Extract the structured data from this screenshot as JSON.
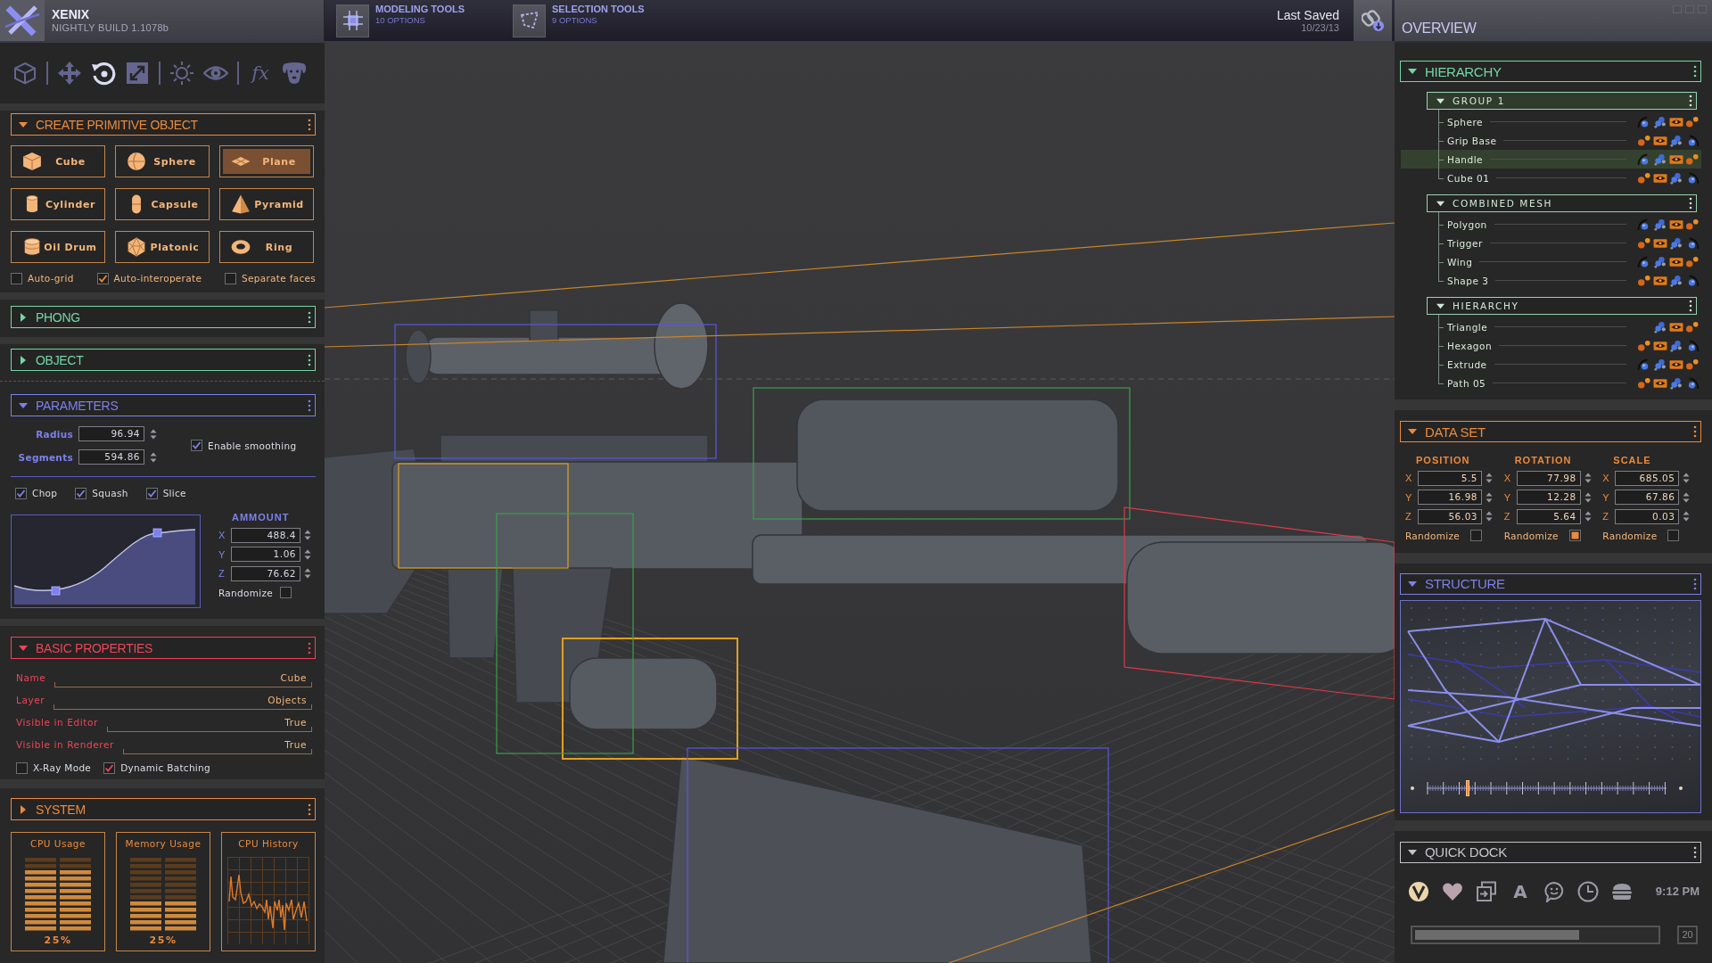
{
  "app": {
    "title": "XENIX",
    "build": "NIGHTLY BUILD 1.1078b"
  },
  "top_tools": [
    {
      "title": "MODELING TOOLS",
      "subtitle": "10 OPTIONS"
    },
    {
      "title": "SELECTION TOOLS",
      "subtitle": "9 OPTIONS"
    }
  ],
  "save_status": {
    "label": "Last Saved",
    "date": "10/23/13"
  },
  "toolbar": {
    "tools": [
      {
        "selected": false
      },
      {
        "selected": false
      },
      {
        "selected": true
      },
      {
        "selected": false
      },
      {
        "selected": false
      },
      {
        "selected": false
      },
      {
        "label": "fx",
        "selected": false
      },
      {
        "selected": false
      }
    ]
  },
  "create_primitive": {
    "title": "CREATE PRIMITIVE OBJECT",
    "expanded": true,
    "buttons": [
      {
        "label": "Cube",
        "selected": false
      },
      {
        "label": "Sphere",
        "selected": false
      },
      {
        "label": "Plane",
        "selected": true
      },
      {
        "label": "Cylinder",
        "selected": false
      },
      {
        "label": "Capsule",
        "selected": false
      },
      {
        "label": "Pyramid",
        "selected": false
      },
      {
        "label": "Oil Drum",
        "selected": false
      },
      {
        "label": "Platonic",
        "selected": false
      },
      {
        "label": "Ring",
        "selected": false
      }
    ],
    "options": [
      {
        "label": "Auto-grid",
        "checked": false
      },
      {
        "label": "Auto-interoperate",
        "checked": true
      },
      {
        "label": "Separate faces",
        "checked": false
      }
    ]
  },
  "phong": {
    "title": "PHONG",
    "expanded": false
  },
  "object": {
    "title": "OBJECT",
    "expanded": false
  },
  "parameters": {
    "title": "PARAMETERS",
    "expanded": true,
    "fields": [
      {
        "label": "Radius",
        "value": "96.94"
      },
      {
        "label": "Segments",
        "value": "594.86"
      }
    ],
    "smoothing": {
      "label": "Enable smoothing",
      "checked": true
    },
    "modifiers": [
      {
        "label": "Chop",
        "checked": true
      },
      {
        "label": "Squash",
        "checked": true
      },
      {
        "label": "Slice",
        "checked": true
      }
    ],
    "amount": {
      "title": "AMMOUNT",
      "fields": [
        {
          "axis": "X",
          "value": "488.4"
        },
        {
          "axis": "Y",
          "value": "1.06"
        },
        {
          "axis": "Z",
          "value": "76.62"
        }
      ],
      "randomize": {
        "label": "Randomize",
        "checked": false
      }
    }
  },
  "basic_properties": {
    "title": "BASIC PROPERTIES",
    "expanded": true,
    "properties": [
      {
        "label": "Name",
        "value": "Cube"
      },
      {
        "label": "Layer",
        "value": "Objects"
      },
      {
        "label": "Visible in Editor",
        "value": "True"
      },
      {
        "label": "Visible in Renderer",
        "value": "True"
      }
    ],
    "options": [
      {
        "label": "X-Ray Mode",
        "checked": false
      },
      {
        "label": "Dynamic Batching",
        "checked": true
      }
    ]
  },
  "system": {
    "title": "SYSTEM",
    "expanded": false,
    "monitors": [
      {
        "kind": "meter",
        "title": "CPU Usage",
        "level": 0.83,
        "reading": "25%"
      },
      {
        "kind": "meter",
        "title": "Memory Usage",
        "level": 0.42,
        "reading": "25%"
      },
      {
        "kind": "history",
        "title": "CPU History"
      }
    ]
  },
  "overview": {
    "title": "OVERVIEW"
  },
  "hierarchy": {
    "title": "HIERARCHY",
    "expanded": true,
    "groups": [
      {
        "title": "GROUP 1",
        "expanded": true,
        "selected": true,
        "items": [
          {
            "label": "Sphere",
            "selected": false,
            "kind": "forward"
          },
          {
            "label": "Grip Base",
            "selected": false,
            "kind": "reverse"
          },
          {
            "label": "Handle",
            "selected": true,
            "kind": "forward"
          },
          {
            "label": "Cube 01",
            "selected": false,
            "kind": "reverse"
          }
        ]
      },
      {
        "title": "COMBINED MESH",
        "expanded": true,
        "selected": false,
        "items": [
          {
            "label": "Polygon",
            "selected": false,
            "kind": "forward"
          },
          {
            "label": "Trigger",
            "selected": false,
            "kind": "reverse"
          },
          {
            "label": "Wing",
            "selected": false,
            "kind": "forward"
          },
          {
            "label": "Shape 3",
            "selected": false,
            "kind": "reverse"
          }
        ]
      },
      {
        "title": "HIERARCHY",
        "expanded": true,
        "selected": false,
        "items": [
          {
            "label": "Triangle",
            "selected": false,
            "kind": "partial"
          },
          {
            "label": "Hexagon",
            "selected": false,
            "kind": "reverse"
          },
          {
            "label": "Extrude",
            "selected": false,
            "kind": "forward"
          },
          {
            "label": "Path 05",
            "selected": false,
            "kind": "reverse"
          }
        ]
      }
    ]
  },
  "data_set": {
    "title": "DATA SET",
    "expanded": true,
    "columns": [
      {
        "title": "POSITION",
        "fields": [
          {
            "axis": "X",
            "value": "5.5"
          },
          {
            "axis": "Y",
            "value": "16.98"
          },
          {
            "axis": "Z",
            "value": "56.03"
          }
        ],
        "randomize": {
          "label": "Randomize",
          "checked": false
        }
      },
      {
        "title": "ROTATION",
        "fields": [
          {
            "axis": "X",
            "value": "77.98"
          },
          {
            "axis": "Y",
            "value": "12.28"
          },
          {
            "axis": "Z",
            "value": "5.64"
          }
        ],
        "randomize": {
          "label": "Randomize",
          "checked": true
        }
      },
      {
        "title": "SCALE",
        "fields": [
          {
            "axis": "X",
            "value": "685.05"
          },
          {
            "axis": "Y",
            "value": "67.86"
          },
          {
            "axis": "Z",
            "value": "0.03"
          }
        ],
        "randomize": {
          "label": "Randomize",
          "checked": false
        }
      }
    ]
  },
  "structure": {
    "title": "STRUCTURE",
    "expanded": true,
    "level": 0.17
  },
  "quick_dock": {
    "title": "QUICK DOCK",
    "expanded": true,
    "text_tool": "A",
    "time": "9:12 PM",
    "level": 0.68,
    "counter": "20"
  }
}
